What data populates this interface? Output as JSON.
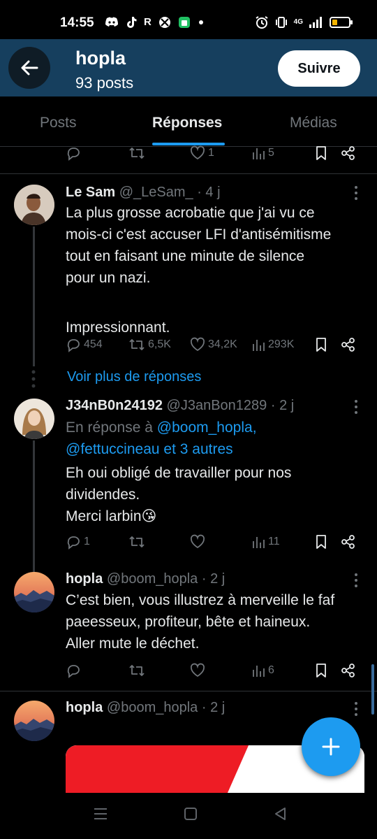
{
  "status_bar": {
    "time": "14:55",
    "left_icons": [
      "discord-icon",
      "tiktok-icon",
      "r-app-icon",
      "xbox-icon",
      "app-icon",
      "dot-icon"
    ],
    "network": "4G",
    "right_icons": [
      "alarm-icon",
      "vibrate-icon",
      "signal-icon",
      "battery-icon"
    ]
  },
  "header": {
    "title": "hopla",
    "subtitle": "93 posts",
    "follow_label": "Suivre"
  },
  "tabs": [
    {
      "label": "Posts",
      "active": false
    },
    {
      "label": "Réponses",
      "active": true
    },
    {
      "label": "Médias",
      "active": false
    }
  ],
  "top_actions": {
    "reply": "",
    "retweet": "",
    "like": "1",
    "views": "5"
  },
  "tweets": [
    {
      "name": "Le Sam",
      "handle": "@_LeSam_",
      "time": "· 4 j",
      "text_lines": [
        "La plus grosse acrobatie que j'ai vu ce",
        "mois-ci c'est accuser LFI d'antisémitisme",
        "tout en faisant une minute de silence",
        "pour un nazi.",
        "",
        "Impressionnant."
      ],
      "stats": {
        "reply": "454",
        "retweet": "6,5K",
        "like": "34,2K",
        "views": "293K"
      }
    },
    {
      "name": "J34nB0n24192",
      "handle": "@J3anBon1289",
      "time": "· 2 j",
      "reply_to_prefix": "En réponse à",
      "reply_to_line1": "@boom_hopla,",
      "reply_to_line2": "@fettuccineau et 3 autres",
      "text_lines": [
        "Eh oui obligé de travailler pour nos",
        "dividendes.",
        "Merci larbin😘"
      ],
      "stats": {
        "reply": "1",
        "retweet": "",
        "like": "",
        "views": "11"
      }
    },
    {
      "name": "hopla",
      "handle": "@boom_hopla",
      "time": "· 2 j",
      "text_lines": [
        "C’est bien, vous illustrez à merveille le faf",
        "paeesseux,  profiteur, bête et haineux.",
        "Aller mute  le déchet."
      ],
      "stats": {
        "reply": "",
        "retweet": "",
        "like": "",
        "views": "6"
      }
    },
    {
      "name": "hopla",
      "handle": "@boom_hopla",
      "time": "· 2 j"
    }
  ],
  "more_replies_label": "Voir plus de réponses",
  "colors": {
    "header_bg": "#163f5e",
    "accent": "#1d9bf0",
    "muted": "#71767b",
    "text": "#e7e9ea"
  },
  "nav_icons": [
    "recent-apps-icon",
    "home-icon",
    "back-nav-icon"
  ]
}
